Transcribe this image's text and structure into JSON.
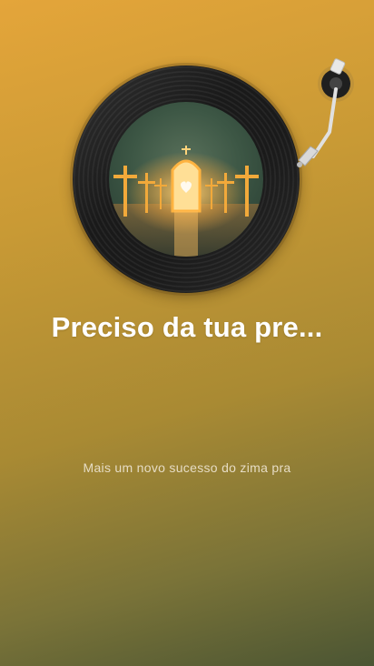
{
  "player": {
    "title": "Preciso da tua pre...",
    "description": "Mais um novo sucesso do zima pra"
  },
  "icons": {
    "record": "vinyl-record-icon",
    "tonearm": "tonearm-icon"
  },
  "colors": {
    "background_top": "#e4a53a",
    "background_bottom": "#4b5533",
    "title_text": "#ffffff",
    "subtitle_text": "#e6dcc4"
  }
}
